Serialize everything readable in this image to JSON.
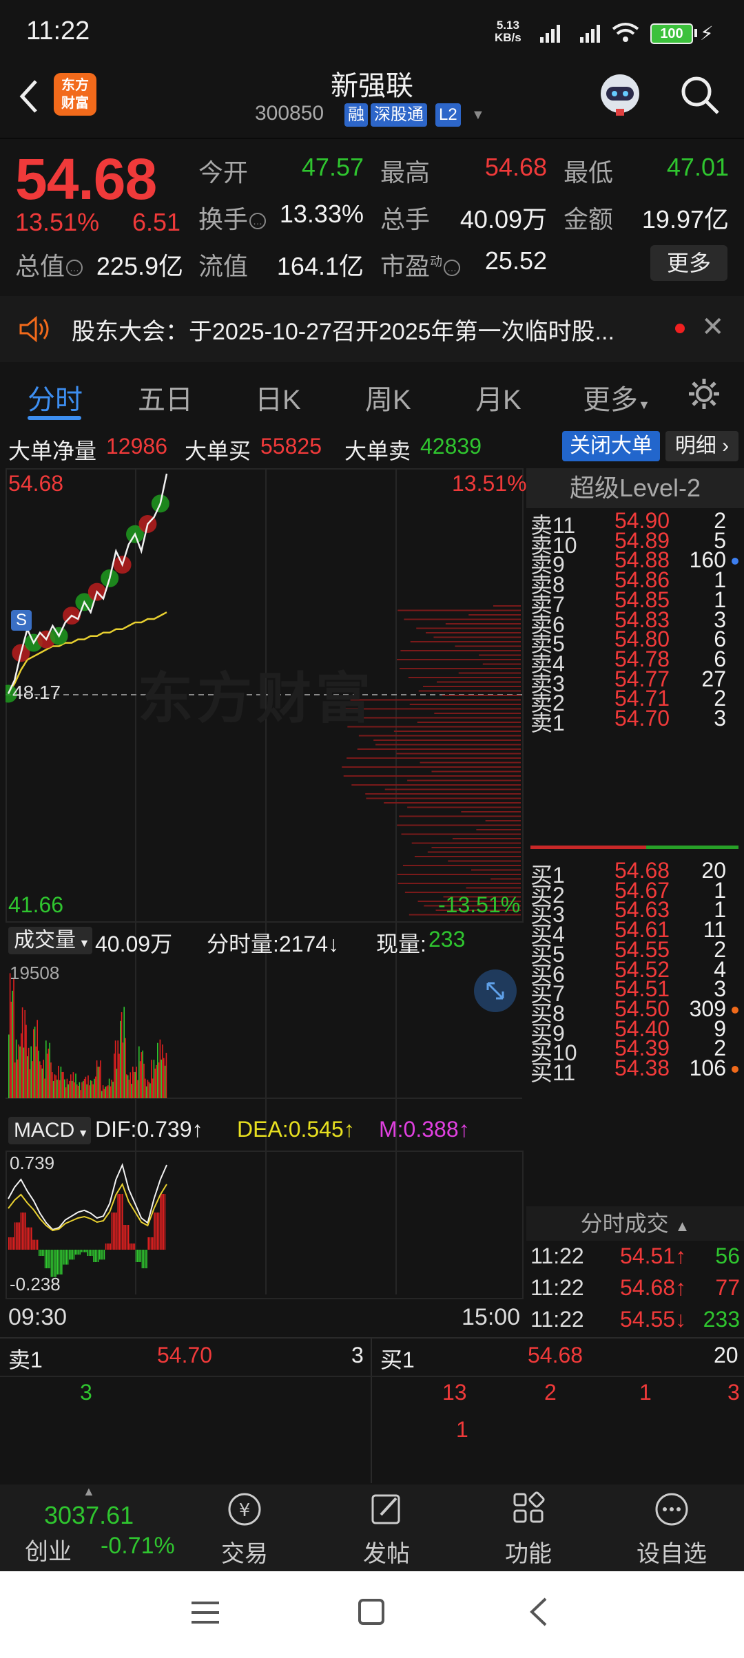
{
  "status": {
    "time": "11:22",
    "net_speed_top": "5.13",
    "net_speed_bottom": "KB/s",
    "battery": "100"
  },
  "header": {
    "name": "新强联",
    "code": "300850",
    "tag_rong": "融",
    "tag_sgt": "深股通",
    "tag_l2": "L2",
    "logo_line1": "东方",
    "logo_line2": "财富"
  },
  "quote": {
    "price": "54.68",
    "pct": "13.51%",
    "change": "6.51",
    "open_label": "今开",
    "open": "47.57",
    "high_label": "最高",
    "high": "54.68",
    "low_label": "最低",
    "low": "47.01",
    "turnover_label": "换手",
    "turnover": "13.33%",
    "volume_label": "总手",
    "volume": "40.09万",
    "amount_label": "金额",
    "amount": "19.97亿",
    "mcap_label": "总值",
    "mcap": "225.9亿",
    "float_label": "流值",
    "float_cap": "164.1亿",
    "pe_label": "市盈",
    "pe_sup": "动",
    "pe": "25.52",
    "more": "更多"
  },
  "announcement": {
    "text": "股东大会：于2025-10-27召开2025年第一次临时股..."
  },
  "tabs": [
    "分时",
    "五日",
    "日K",
    "周K",
    "月K",
    "更多"
  ],
  "big_order": {
    "net_label": "大单净量",
    "net": "12986",
    "buy_label": "大单买",
    "buy": "55825",
    "sell_label": "大单卖",
    "sell": "42839",
    "close_btn": "关闭大单",
    "detail_btn": "明细"
  },
  "chart": {
    "price_high": "54.68",
    "pct_high": "13.51%",
    "price_low": "41.66",
    "pct_low": "-13.51%",
    "prev_close": "48.17",
    "watermark": "东方财富",
    "s_badge": "S",
    "vol_selector": "成交量",
    "vol_total": "40.09万",
    "vol_minute": "分时量:2174↓",
    "vol_now_label": "现量:",
    "vol_now": "233",
    "vol_max": "19508",
    "macd_selector": "MACD",
    "dif": "DIF:0.739↑",
    "dea": "DEA:0.545↑",
    "m": "M:0.388↑",
    "macd_max": "0.739",
    "macd_min": "-0.238",
    "time_start": "09:30",
    "time_end": "15:00"
  },
  "chart_data": {
    "type": "line",
    "title": "",
    "ylim": [
      41.66,
      54.68
    ],
    "prev_close": 48.17,
    "price": [
      48.2,
      48.6,
      49.4,
      50.1,
      49.7,
      50.0,
      49.8,
      50.2,
      49.9,
      50.3,
      50.5,
      50.4,
      50.9,
      50.6,
      51.2,
      51.0,
      51.6,
      52.4,
      52.0,
      52.6,
      52.9,
      52.4,
      53.2,
      53.4,
      53.8,
      54.68
    ],
    "avg": [
      48.2,
      48.5,
      48.9,
      49.2,
      49.3,
      49.4,
      49.5,
      49.6,
      49.6,
      49.7,
      49.7,
      49.8,
      49.8,
      49.9,
      49.9,
      50.0,
      50.0,
      50.1,
      50.1,
      50.2,
      50.3,
      50.3,
      50.4,
      50.4,
      50.5,
      50.6
    ],
    "volume": [
      19508,
      9000,
      14000,
      8000,
      12000,
      6000,
      9000,
      4000,
      5000,
      3000,
      4000,
      2500,
      3500,
      3000,
      6000,
      2000,
      3000,
      9000,
      14000,
      4000,
      5000,
      8000,
      3000,
      6000,
      9000,
      7000
    ],
    "macd_hist": [
      0.1,
      0.22,
      0.3,
      0.18,
      0.08,
      -0.05,
      -0.15,
      -0.22,
      -0.2,
      -0.12,
      -0.08,
      -0.04,
      -0.02,
      -0.05,
      -0.1,
      -0.08,
      0.05,
      0.3,
      0.45,
      0.2,
      0.05,
      -0.1,
      -0.15,
      0.1,
      0.3,
      0.45
    ]
  },
  "level2": {
    "title": "超级Level-2",
    "asks": [
      {
        "label": "卖11",
        "price": "54.90",
        "vol": "2",
        "dot": ""
      },
      {
        "label": "卖10",
        "price": "54.89",
        "vol": "5",
        "dot": ""
      },
      {
        "label": "卖9",
        "price": "54.88",
        "vol": "160",
        "dot": "#3d7ff0"
      },
      {
        "label": "卖8",
        "price": "54.86",
        "vol": "1",
        "dot": ""
      },
      {
        "label": "卖7",
        "price": "54.85",
        "vol": "1",
        "dot": ""
      },
      {
        "label": "卖6",
        "price": "54.83",
        "vol": "3",
        "dot": ""
      },
      {
        "label": "卖5",
        "price": "54.80",
        "vol": "6",
        "dot": ""
      },
      {
        "label": "卖4",
        "price": "54.78",
        "vol": "6",
        "dot": ""
      },
      {
        "label": "卖3",
        "price": "54.77",
        "vol": "27",
        "dot": ""
      },
      {
        "label": "卖2",
        "price": "54.71",
        "vol": "2",
        "dot": ""
      },
      {
        "label": "卖1",
        "price": "54.70",
        "vol": "3",
        "dot": ""
      }
    ],
    "bids": [
      {
        "label": "买1",
        "price": "54.68",
        "vol": "20",
        "dot": ""
      },
      {
        "label": "买2",
        "price": "54.67",
        "vol": "1",
        "dot": ""
      },
      {
        "label": "买3",
        "price": "54.63",
        "vol": "1",
        "dot": ""
      },
      {
        "label": "买4",
        "price": "54.61",
        "vol": "11",
        "dot": ""
      },
      {
        "label": "买5",
        "price": "54.55",
        "vol": "2",
        "dot": ""
      },
      {
        "label": "买6",
        "price": "54.52",
        "vol": "4",
        "dot": ""
      },
      {
        "label": "买7",
        "price": "54.51",
        "vol": "3",
        "dot": ""
      },
      {
        "label": "买8",
        "price": "54.50",
        "vol": "309",
        "dot": "#f06a1b"
      },
      {
        "label": "买9",
        "price": "54.40",
        "vol": "9",
        "dot": ""
      },
      {
        "label": "买10",
        "price": "54.39",
        "vol": "2",
        "dot": ""
      },
      {
        "label": "买11",
        "price": "54.38",
        "vol": "106",
        "dot": "#f06a1b"
      }
    ],
    "trades_title": "分时成交",
    "trades": [
      {
        "time": "11:22",
        "price": "54.51↑",
        "vol": "56",
        "color": "#2fc52f"
      },
      {
        "time": "11:22",
        "price": "54.68↑",
        "vol": "77",
        "color": "#f03a3a"
      },
      {
        "time": "11:22",
        "price": "54.55↓",
        "vol": "233",
        "color": "#2fc52f"
      }
    ]
  },
  "queue": {
    "sell_label": "卖1",
    "sell_price": "54.70",
    "sell_vol": "3",
    "buy_label": "买1",
    "buy_price": "54.68",
    "buy_vol": "20",
    "sell_orders": [
      "3"
    ],
    "buy_orders_row1": [
      "13",
      "2",
      "1",
      "3"
    ],
    "buy_orders_row2": [
      "1"
    ]
  },
  "bottom": {
    "index_value": "3037.61",
    "index_name": "创业",
    "index_change": "-0.71%",
    "trade": "交易",
    "post": "发帖",
    "function": "功能",
    "watchlist": "设自选"
  }
}
